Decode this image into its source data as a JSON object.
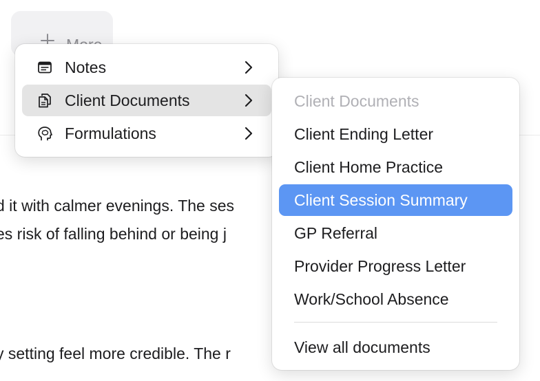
{
  "more_button": {
    "label": "More",
    "icon": "plus-icon"
  },
  "background_text": {
    "line1": "d it with calmer evenings. The ses",
    "line2": "es risk of falling behind or being j",
    "line3": "y setting feel more credible. The r"
  },
  "main_menu": {
    "items": [
      {
        "label": "Notes",
        "icon": "note-icon",
        "has_submenu": true,
        "active": false
      },
      {
        "label": "Client Documents",
        "icon": "documents-icon",
        "has_submenu": true,
        "active": true
      },
      {
        "label": "Formulations",
        "icon": "head-brain-icon",
        "has_submenu": true,
        "active": false
      }
    ]
  },
  "submenu": {
    "header": "Client Documents",
    "items": [
      {
        "label": "Client Ending Letter",
        "highlighted": false
      },
      {
        "label": "Client Home Practice",
        "highlighted": false
      },
      {
        "label": "Client Session Summary",
        "highlighted": true
      },
      {
        "label": "GP Referral",
        "highlighted": false
      },
      {
        "label": "Provider Progress Letter",
        "highlighted": false
      },
      {
        "label": "Work/School Absence",
        "highlighted": false
      }
    ],
    "footer": "View all documents"
  },
  "colors": {
    "highlight": "#5c96f3",
    "active_row": "#e4e4e4",
    "muted_text": "#8e8e93",
    "header_text": "#b0b0b5"
  }
}
